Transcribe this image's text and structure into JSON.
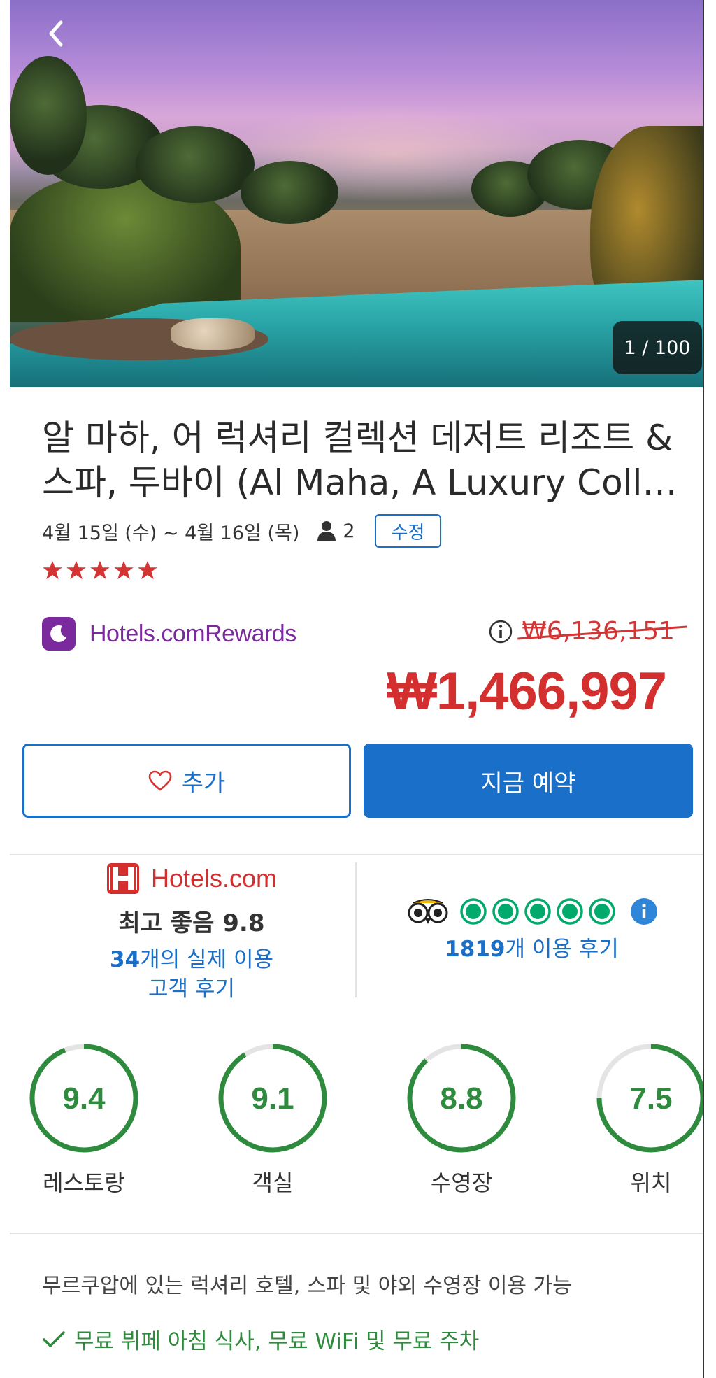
{
  "hero": {
    "photo_counter": "1 / 100"
  },
  "hotel": {
    "title_line1": "알 마하, 어 럭셔리 컬렉션 데저트 리조트 &",
    "title_line2": "스파, 두바이 (Al Maha, A Luxury Coll…",
    "dates": "4월 15일 (수) ~ 4월 16일 (목)",
    "guests": "2",
    "edit_label": "수정",
    "stars": 5
  },
  "rewards": {
    "brand_part1": "Hotels.com",
    "brand_part2": "Rewards"
  },
  "price": {
    "original": "₩6,136,151",
    "current": "₩1,466,997"
  },
  "actions": {
    "add_label": "추가",
    "book_label": "지금 예약"
  },
  "reviews": {
    "hotels_brand": "Hotels.com",
    "score_text": "최고 좋음 9.8",
    "count_number": "34",
    "count_suffix": "개의 실제 이용",
    "count_line2": "고객 후기",
    "tripadvisor_count": "1819",
    "tripadvisor_suffix": "개 이용 후기",
    "tripadvisor_bubbles": 5
  },
  "ratings": [
    {
      "value": "9.4",
      "label": "레스토랑",
      "fraction": 0.94
    },
    {
      "value": "9.1",
      "label": "객실",
      "fraction": 0.91
    },
    {
      "value": "8.8",
      "label": "수영장",
      "fraction": 0.88
    },
    {
      "value": "7.5",
      "label": "위치",
      "fraction": 0.75
    }
  ],
  "description": "무르쿠압에 있는 럭셔리 호텔, 스파 및 야외 수영장 이용 가능",
  "amenities": "무료 뷔페 아침 식사, 무료 WiFi 및 무료 주차",
  "colors": {
    "accent_blue": "#1a6fc9",
    "price_red": "#d32f2f",
    "rating_green": "#2e8b3e",
    "rewards_purple": "#7b2a9e",
    "tripadvisor_green": "#00aa6c"
  }
}
